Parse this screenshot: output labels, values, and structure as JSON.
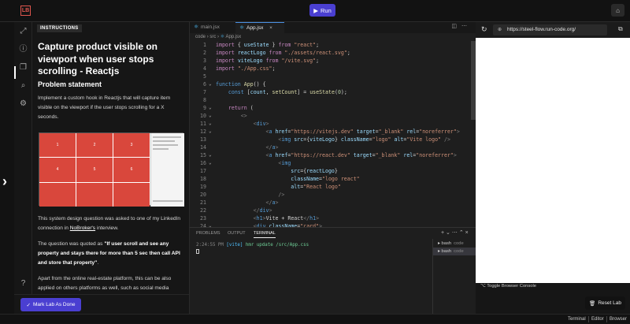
{
  "topbar": {
    "logo": "LB",
    "run_label": "Run",
    "run_icon": "play-icon",
    "right_icon": "home-icon"
  },
  "panel": {
    "badge": "INSTRUCTIONS",
    "title": "Capture product visible on viewport when user stops scrolling - Reactjs",
    "subtitle": "Problem statement",
    "p1": "Implement a custom hook in Reactjs that will capture item visible on the viewport if the user stops scrolling for a X seconds.",
    "preview_cells": [
      "1",
      "2",
      "3",
      "4",
      "5",
      "6"
    ],
    "p2_a": "This system design question was asked to one of my LinkedIn connection in ",
    "p2_link": "NoBroker's",
    "p2_b": " interview.",
    "p3_a": "The question was quoted as ",
    "p3_bold": "\"If user scroll and see any property and stays there for more than 5 sec then call API and store that property\"",
    "p3_b": ".",
    "p4": "Apart from the online real-estate platform, this can be also applied on others platforms as well, such as social media"
  },
  "mark_done": "Mark Lab As Done",
  "editor": {
    "tabs": [
      {
        "label": "main.jsx"
      },
      {
        "label": "App.jsx"
      }
    ],
    "crumbs": [
      "code",
      "src",
      "App.jsx"
    ],
    "lines": [
      {
        "n": "1",
        "fold": "",
        "html": "<span class='kw2'>import</span> <span class='txt'>{ </span><span class='var'>useState</span><span class='txt'> } </span><span class='kw2'>from</span> <span class='str'>\"react\"</span><span class='txt'>;</span>"
      },
      {
        "n": "2",
        "fold": "",
        "html": "<span class='kw2'>import</span> <span class='var'>reactLogo</span> <span class='kw2'>from</span> <span class='str'>\"./assets/react.svg\"</span><span class='txt'>;</span>"
      },
      {
        "n": "3",
        "fold": "",
        "html": "<span class='kw2'>import</span> <span class='var'>viteLogo</span> <span class='kw2'>from</span> <span class='str'>\"/vite.svg\"</span><span class='txt'>;</span>"
      },
      {
        "n": "4",
        "fold": "",
        "html": "<span class='kw2'>import</span> <span class='str'>\"./App.css\"</span><span class='txt'>;</span>"
      },
      {
        "n": "5",
        "fold": "",
        "html": ""
      },
      {
        "n": "6",
        "fold": "v",
        "html": "<span class='kw'>function</span> <span class='fn'>App</span><span class='txt'>() {</span>"
      },
      {
        "n": "7",
        "fold": "",
        "html": "    <span class='kw'>const</span> <span class='txt'>[</span><span class='var'>count</span><span class='txt'>, </span><span class='fn'>setCount</span><span class='txt'>] = </span><span class='fn'>useState</span><span class='txt'>(</span><span class='num'>0</span><span class='txt'>);</span>"
      },
      {
        "n": "8",
        "fold": "",
        "html": ""
      },
      {
        "n": "9",
        "fold": "v",
        "html": "    <span class='kw2'>return</span> <span class='txt'>(</span>"
      },
      {
        "n": "10",
        "fold": "v",
        "html": "        <span class='pun'>&lt;&gt;</span>"
      },
      {
        "n": "11",
        "fold": "v",
        "html": "            <span class='pun'>&lt;</span><span class='tag'>div</span><span class='pun'>&gt;</span>"
      },
      {
        "n": "12",
        "fold": "v",
        "html": "                <span class='pun'>&lt;</span><span class='tag'>a</span> <span class='attr'>href</span><span class='txt'>=</span><span class='str'>\"https://vitejs.dev\"</span> <span class='attr'>target</span><span class='txt'>=</span><span class='str'>\"_blank\"</span> <span class='attr'>rel</span><span class='txt'>=</span><span class='str'>\"noreferrer\"</span><span class='pun'>&gt;</span>"
      },
      {
        "n": "13",
        "fold": "",
        "html": "                    <span class='pun'>&lt;</span><span class='tag'>img</span> <span class='attr'>src</span><span class='txt'>={</span><span class='var'>viteLogo</span><span class='txt'>}</span> <span class='attr'>className</span><span class='txt'>=</span><span class='str'>\"logo\"</span> <span class='attr'>alt</span><span class='txt'>=</span><span class='str'>\"Vite logo\"</span> <span class='pun'>/&gt;</span>"
      },
      {
        "n": "14",
        "fold": "",
        "html": "                <span class='pun'>&lt;/</span><span class='tag'>a</span><span class='pun'>&gt;</span>"
      },
      {
        "n": "15",
        "fold": "v",
        "html": "                <span class='pun'>&lt;</span><span class='tag'>a</span> <span class='attr'>href</span><span class='txt'>=</span><span class='str'>\"https://react.dev\"</span> <span class='attr'>target</span><span class='txt'>=</span><span class='str'>\"_blank\"</span> <span class='attr'>rel</span><span class='txt'>=</span><span class='str'>\"noreferrer\"</span><span class='pun'>&gt;</span>"
      },
      {
        "n": "16",
        "fold": "v",
        "html": "                    <span class='pun'>&lt;</span><span class='tag'>img</span>"
      },
      {
        "n": "17",
        "fold": "",
        "html": "                        <span class='attr'>src</span><span class='txt'>={</span><span class='var'>reactLogo</span><span class='txt'>}</span>"
      },
      {
        "n": "18",
        "fold": "",
        "html": "                        <span class='attr'>className</span><span class='txt'>=</span><span class='str'>\"logo react\"</span>"
      },
      {
        "n": "19",
        "fold": "",
        "html": "                        <span class='attr'>alt</span><span class='txt'>=</span><span class='str'>\"React logo\"</span>"
      },
      {
        "n": "20",
        "fold": "",
        "html": "                    <span class='pun'>/&gt;</span>"
      },
      {
        "n": "21",
        "fold": "",
        "html": "                <span class='pun'>&lt;/</span><span class='tag'>a</span><span class='pun'>&gt;</span>"
      },
      {
        "n": "22",
        "fold": "",
        "html": "            <span class='pun'>&lt;/</span><span class='tag'>div</span><span class='pun'>&gt;</span>"
      },
      {
        "n": "23",
        "fold": "",
        "html": "            <span class='pun'>&lt;</span><span class='tag'>h1</span><span class='pun'>&gt;</span><span class='txt'>Vite + React</span><span class='pun'>&lt;/</span><span class='tag'>h1</span><span class='pun'>&gt;</span>"
      },
      {
        "n": "24",
        "fold": "v",
        "html": "            <span class='pun'>&lt;</span><span class='tag'>div</span> <span class='attr'>className</span><span class='txt'>=</span><span class='str'>\"card\"</span><span class='pun'>&gt;</span>"
      }
    ]
  },
  "terminal": {
    "tabs": [
      "PROBLEMS",
      "OUTPUT",
      "TERMINAL"
    ],
    "log_time": "2:24:55 PM",
    "log_tag": "[vite]",
    "log_msg": "hmr update /src/App.css",
    "shells": [
      {
        "name": "bash",
        "sub": "code"
      },
      {
        "name": "bash",
        "sub": "code"
      }
    ]
  },
  "browser": {
    "url": "https://steel-flow.run-code.org/",
    "console_label": "Toggle Browser Console",
    "reset_label": "Reset Lab"
  },
  "status": {
    "items": [
      "Terminal",
      "Editor",
      "Browser"
    ]
  }
}
